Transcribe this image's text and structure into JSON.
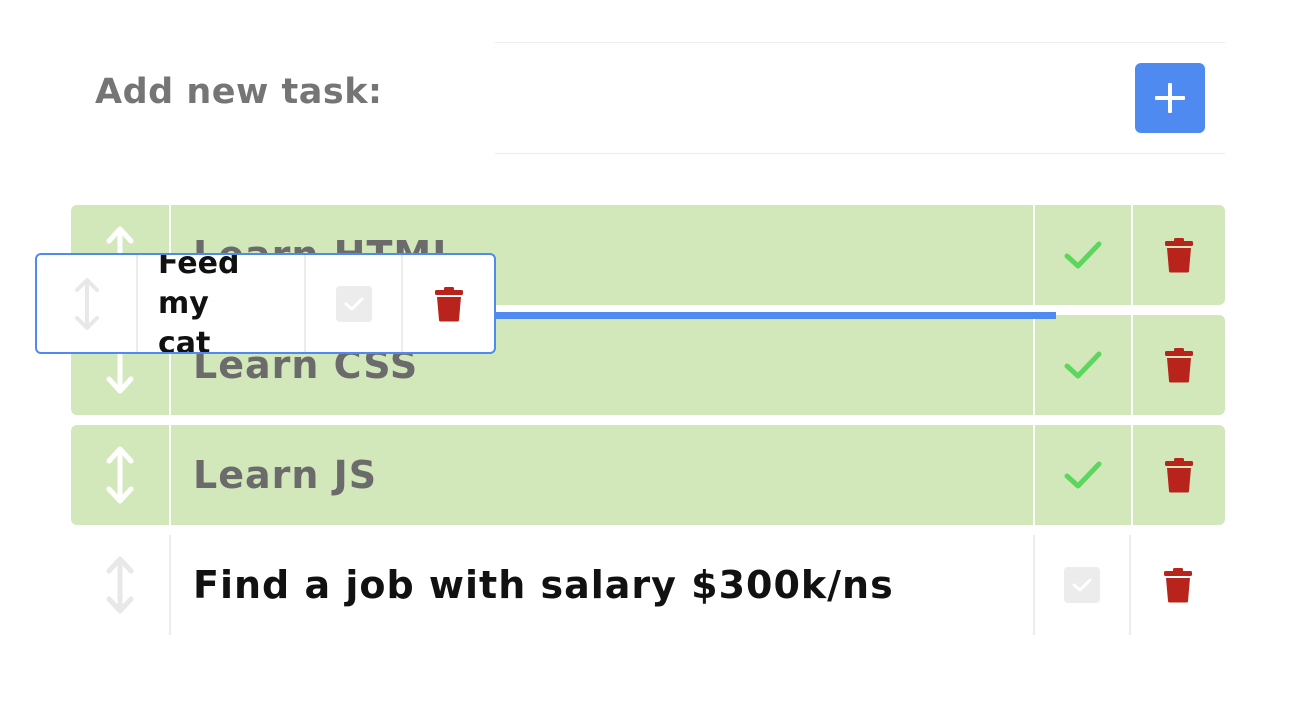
{
  "add_task": {
    "label": "Add new task:",
    "input_value": "",
    "add_button_icon": "plus-icon"
  },
  "tasks": [
    {
      "text": "Learn HTML",
      "done": true
    },
    {
      "text": "Learn CSS",
      "done": true
    },
    {
      "text": "Learn JS",
      "done": true
    },
    {
      "text": "Find a job with salary $300k/ns",
      "done": false
    }
  ],
  "dragging_task": {
    "text": "Feed my cat",
    "done": false
  },
  "icons": {
    "drag": "arrows-vertical-icon",
    "done": "checkmark-icon",
    "todo": "checkbox-icon",
    "delete": "trash-icon"
  },
  "colors": {
    "accent": "#4f8af0",
    "done_row_bg": "#d2e8bb",
    "check_green": "#5cd65c",
    "delete_red": "#b8241b",
    "muted_text": "#757575"
  }
}
